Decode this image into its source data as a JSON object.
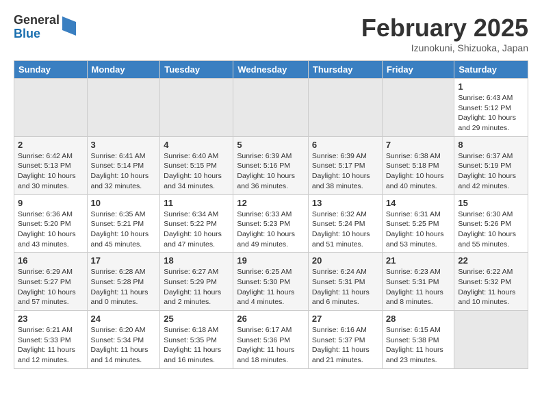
{
  "header": {
    "logo": {
      "general": "General",
      "blue": "Blue",
      "tagline": ""
    },
    "title": "February 2025",
    "location": "Izunokuni, Shizuoka, Japan"
  },
  "weekdays": [
    "Sunday",
    "Monday",
    "Tuesday",
    "Wednesday",
    "Thursday",
    "Friday",
    "Saturday"
  ],
  "weeks": [
    [
      {
        "day": "",
        "info": ""
      },
      {
        "day": "",
        "info": ""
      },
      {
        "day": "",
        "info": ""
      },
      {
        "day": "",
        "info": ""
      },
      {
        "day": "",
        "info": ""
      },
      {
        "day": "",
        "info": ""
      },
      {
        "day": "1",
        "info": "Sunrise: 6:43 AM\nSunset: 5:12 PM\nDaylight: 10 hours and 29 minutes."
      }
    ],
    [
      {
        "day": "2",
        "info": "Sunrise: 6:42 AM\nSunset: 5:13 PM\nDaylight: 10 hours and 30 minutes."
      },
      {
        "day": "3",
        "info": "Sunrise: 6:41 AM\nSunset: 5:14 PM\nDaylight: 10 hours and 32 minutes."
      },
      {
        "day": "4",
        "info": "Sunrise: 6:40 AM\nSunset: 5:15 PM\nDaylight: 10 hours and 34 minutes."
      },
      {
        "day": "5",
        "info": "Sunrise: 6:39 AM\nSunset: 5:16 PM\nDaylight: 10 hours and 36 minutes."
      },
      {
        "day": "6",
        "info": "Sunrise: 6:39 AM\nSunset: 5:17 PM\nDaylight: 10 hours and 38 minutes."
      },
      {
        "day": "7",
        "info": "Sunrise: 6:38 AM\nSunset: 5:18 PM\nDaylight: 10 hours and 40 minutes."
      },
      {
        "day": "8",
        "info": "Sunrise: 6:37 AM\nSunset: 5:19 PM\nDaylight: 10 hours and 42 minutes."
      }
    ],
    [
      {
        "day": "9",
        "info": "Sunrise: 6:36 AM\nSunset: 5:20 PM\nDaylight: 10 hours and 43 minutes."
      },
      {
        "day": "10",
        "info": "Sunrise: 6:35 AM\nSunset: 5:21 PM\nDaylight: 10 hours and 45 minutes."
      },
      {
        "day": "11",
        "info": "Sunrise: 6:34 AM\nSunset: 5:22 PM\nDaylight: 10 hours and 47 minutes."
      },
      {
        "day": "12",
        "info": "Sunrise: 6:33 AM\nSunset: 5:23 PM\nDaylight: 10 hours and 49 minutes."
      },
      {
        "day": "13",
        "info": "Sunrise: 6:32 AM\nSunset: 5:24 PM\nDaylight: 10 hours and 51 minutes."
      },
      {
        "day": "14",
        "info": "Sunrise: 6:31 AM\nSunset: 5:25 PM\nDaylight: 10 hours and 53 minutes."
      },
      {
        "day": "15",
        "info": "Sunrise: 6:30 AM\nSunset: 5:26 PM\nDaylight: 10 hours and 55 minutes."
      }
    ],
    [
      {
        "day": "16",
        "info": "Sunrise: 6:29 AM\nSunset: 5:27 PM\nDaylight: 10 hours and 57 minutes."
      },
      {
        "day": "17",
        "info": "Sunrise: 6:28 AM\nSunset: 5:28 PM\nDaylight: 11 hours and 0 minutes."
      },
      {
        "day": "18",
        "info": "Sunrise: 6:27 AM\nSunset: 5:29 PM\nDaylight: 11 hours and 2 minutes."
      },
      {
        "day": "19",
        "info": "Sunrise: 6:25 AM\nSunset: 5:30 PM\nDaylight: 11 hours and 4 minutes."
      },
      {
        "day": "20",
        "info": "Sunrise: 6:24 AM\nSunset: 5:31 PM\nDaylight: 11 hours and 6 minutes."
      },
      {
        "day": "21",
        "info": "Sunrise: 6:23 AM\nSunset: 5:31 PM\nDaylight: 11 hours and 8 minutes."
      },
      {
        "day": "22",
        "info": "Sunrise: 6:22 AM\nSunset: 5:32 PM\nDaylight: 11 hours and 10 minutes."
      }
    ],
    [
      {
        "day": "23",
        "info": "Sunrise: 6:21 AM\nSunset: 5:33 PM\nDaylight: 11 hours and 12 minutes."
      },
      {
        "day": "24",
        "info": "Sunrise: 6:20 AM\nSunset: 5:34 PM\nDaylight: 11 hours and 14 minutes."
      },
      {
        "day": "25",
        "info": "Sunrise: 6:18 AM\nSunset: 5:35 PM\nDaylight: 11 hours and 16 minutes."
      },
      {
        "day": "26",
        "info": "Sunrise: 6:17 AM\nSunset: 5:36 PM\nDaylight: 11 hours and 18 minutes."
      },
      {
        "day": "27",
        "info": "Sunrise: 6:16 AM\nSunset: 5:37 PM\nDaylight: 11 hours and 21 minutes."
      },
      {
        "day": "28",
        "info": "Sunrise: 6:15 AM\nSunset: 5:38 PM\nDaylight: 11 hours and 23 minutes."
      },
      {
        "day": "",
        "info": ""
      }
    ]
  ]
}
